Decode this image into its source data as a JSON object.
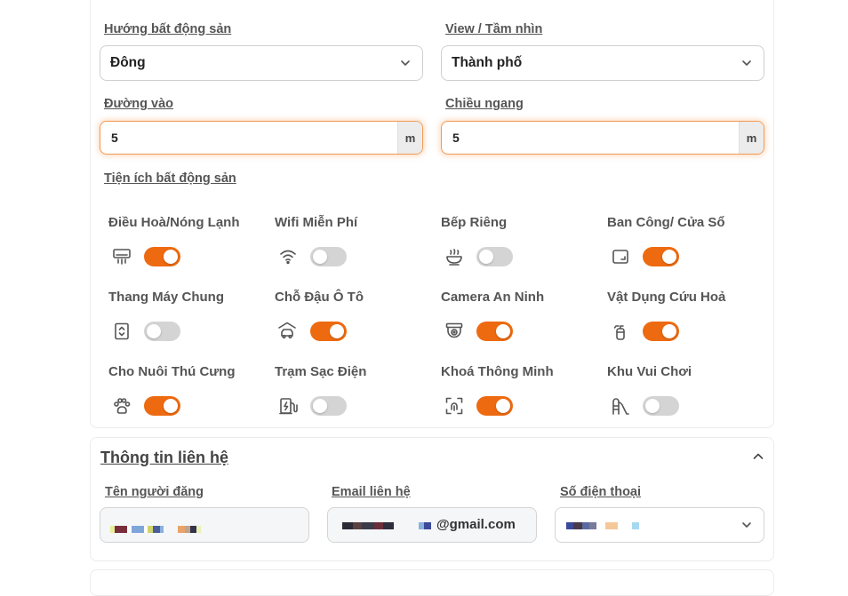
{
  "property": {
    "direction_label": "Hướng bất động sản",
    "direction_value": "Đông",
    "view_label": "View / Tầm nhìn",
    "view_value": "Thành phố",
    "road_label": "Đường vào",
    "road_value": "5",
    "road_unit": "m",
    "width_label": "Chiều ngang",
    "width_value": "5",
    "width_unit": "m",
    "amenities_label": "Tiện ích bất động sản"
  },
  "amenities": [
    {
      "label": "Điều Hoà/Nóng Lạnh",
      "icon": "air-conditioner-icon",
      "on": true
    },
    {
      "label": "Wifi Miễn Phí",
      "icon": "wifi-icon",
      "on": false
    },
    {
      "label": "Bếp Riêng",
      "icon": "kitchen-bowl-icon",
      "on": false
    },
    {
      "label": "Ban Công/ Cửa Sổ",
      "icon": "window-icon",
      "on": true
    },
    {
      "label": "Thang Máy Chung",
      "icon": "elevator-icon",
      "on": false
    },
    {
      "label": "Chỗ Đậu Ô Tô",
      "icon": "garage-car-icon",
      "on": true
    },
    {
      "label": "Camera An Ninh",
      "icon": "security-camera-icon",
      "on": true
    },
    {
      "label": "Vật Dụng Cứu Hoả",
      "icon": "fire-extinguisher-icon",
      "on": true
    },
    {
      "label": "Cho Nuôi Thú Cưng",
      "icon": "paw-icon",
      "on": true
    },
    {
      "label": "Trạm Sạc Điện",
      "icon": "ev-charger-icon",
      "on": false
    },
    {
      "label": "Khoá Thông Minh",
      "icon": "smart-lock-icon",
      "on": true
    },
    {
      "label": "Khu Vui Chơi",
      "icon": "playground-slide-icon",
      "on": false
    }
  ],
  "contact": {
    "title": "Thông tin liên hệ",
    "name_label": "Tên người đăng",
    "email_label": "Email liên hệ",
    "email_suffix": "@gmail.com",
    "phone_label": "Số điện thoại"
  },
  "colors": {
    "accent": "#ee6a10",
    "toggle_off": "#d4d4d4",
    "input_focus_border": "#f29a55"
  }
}
